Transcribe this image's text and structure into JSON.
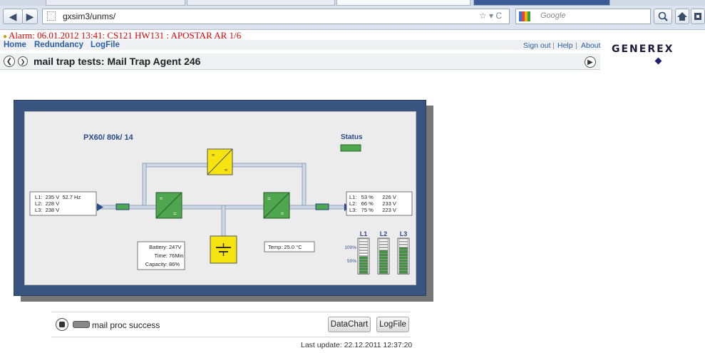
{
  "browser": {
    "url": "gxsim3/unms/",
    "search_placeholder": "Google",
    "back_glyph": "◀",
    "fwd_glyph": "▶",
    "url_controls": "☆ ▾ C"
  },
  "alarm": {
    "text": "Alarm: 06.01.2012 13:41: CS121 HW131 : APOSTAR AR 1/6"
  },
  "menu": {
    "home": "Home",
    "redundancy": "Redundancy",
    "logfile": "LogFile",
    "sign_out": "Sign out",
    "help": "Help",
    "about": "About",
    "separator": "|"
  },
  "logo": "GENEREX",
  "page_title": "mail trap tests: Mail Trap Agent 246",
  "device": {
    "name": "PX60/ 80k/ 14",
    "status_label": "Status",
    "input": {
      "l1": "L1:  235 V  52.7 Hz",
      "l2": "L2:  228 V",
      "l3": "L3:  238 V"
    },
    "output": {
      "l1": "L1:   53 %      226 V",
      "l2": "L2:   66 %      233 V",
      "l3": "L3:   75 %      223 V"
    },
    "battery": {
      "voltage_label": "Battery:",
      "voltage": "247V",
      "time_label": "Time:",
      "time": "76Min",
      "capacity_label": "Capacity:",
      "capacity": "86%"
    },
    "temp": "Temp: 25.0 °C",
    "load_labels": [
      "L1",
      "L2",
      "L3"
    ],
    "load_scale": [
      "100%",
      "50%"
    ],
    "load_levels": [
      0.53,
      0.66,
      0.75
    ],
    "symbol_ac": "≈"
  },
  "colors": {
    "panel_frame": "#3a5480",
    "green": "#4ea64e",
    "yellow": "#f5e40f",
    "alarm": "#dd0000",
    "link": "#2b5fa6"
  },
  "footer": {
    "status": "mail proc success",
    "datachart": "DataChart",
    "logfile": "LogFile",
    "last_update": "Last update: 22.12.2011 12:37:20"
  }
}
